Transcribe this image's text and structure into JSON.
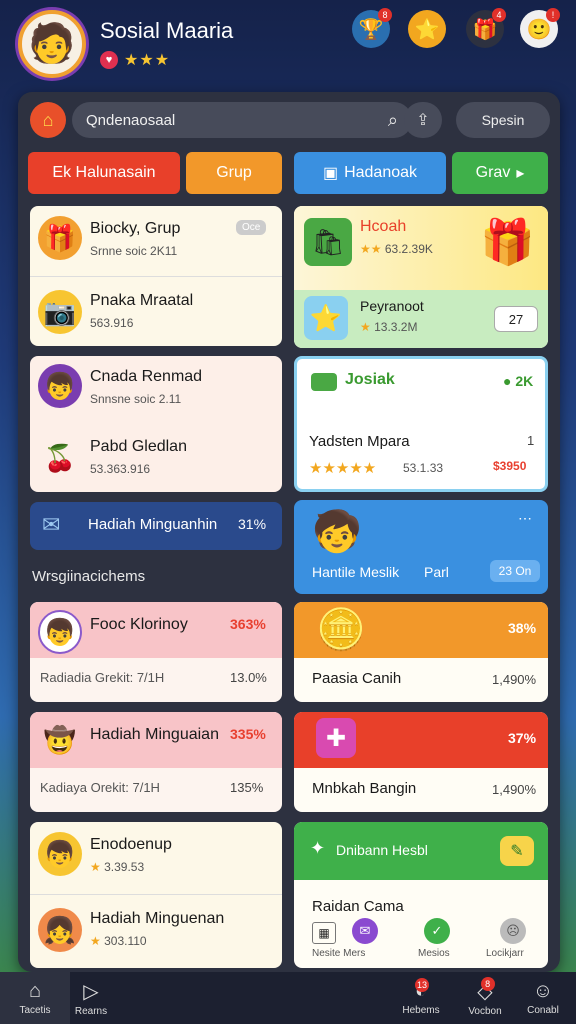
{
  "header": {
    "title": "Sosial Maaria",
    "stars": "★★★",
    "icons": [
      {
        "name": "trophy-icon",
        "badge": "8"
      },
      {
        "name": "star-icon",
        "badge": ""
      },
      {
        "name": "gift-icon",
        "badge": "4"
      },
      {
        "name": "profile-icon",
        "badge": "!"
      }
    ]
  },
  "search": {
    "placeholder": "Qndenaosaal",
    "button_label": "Spesin"
  },
  "tabs": [
    {
      "label": "Ek Halunasain"
    },
    {
      "label": "Grup"
    },
    {
      "label": "Hadanoak"
    },
    {
      "label": "Grav"
    }
  ],
  "left_cards": [
    {
      "title": "Biocky, Grup",
      "sub": "Srnne soic 2K11",
      "badge": "Oce"
    },
    {
      "title": "Pnaka Mraatal",
      "sub": "563.916"
    },
    {
      "title": "Cnada Renmad",
      "sub": "Snnsne soic 2.11"
    },
    {
      "title": "Pabd Gledlan",
      "sub": "53.363.916"
    },
    {
      "title": "Hadiah Minguanhin",
      "value": "31%"
    },
    {
      "section": "Wrsgiinacichems"
    },
    {
      "title": "Fooc Klorinoy",
      "pct": "363%",
      "sub": "Radiadia Grekit: 7/1H",
      "value": "13.0%"
    },
    {
      "title": "Hadiah Minguaian",
      "pct": "335%",
      "sub": "Kadiaya Orekit: 7/1H",
      "value": "135%"
    },
    {
      "title": "Enodoenup",
      "sub": "3.39.53"
    },
    {
      "title": "Hadiah Minguenan",
      "sub": "303.110"
    }
  ],
  "right_cards": [
    {
      "title": "Hcoah",
      "sub": "63.2.39K"
    },
    {
      "title": "Peyranoot",
      "sub": "13.3.2M",
      "value": "27"
    },
    {
      "title": "Josiak",
      "value": "2K"
    },
    {
      "title": "Yadsten Mpara",
      "sub": "53.1.33",
      "value": "1",
      "badge": "$3950"
    },
    {
      "title": "Hantile Meslik",
      "sub": "Parl",
      "value": "23 On"
    },
    {
      "pct": "38%",
      "title": "Paasia Canih",
      "value": "1,490%"
    },
    {
      "pct": "37%",
      "title": "Mnbkah Bangin",
      "value": "1,490%"
    },
    {
      "header": "Dnibann Hesbl",
      "title": "Raidan Cama"
    }
  ],
  "bottom_icons": [
    {
      "label": "Nesite Mers"
    },
    {
      "label": "Mesios"
    },
    {
      "label": "Locikjarr"
    }
  ],
  "nav": [
    {
      "label": "Tacetis"
    },
    {
      "label": "Rearns"
    },
    {
      "label": "Hebems",
      "badge": "13"
    },
    {
      "label": "Vocbon",
      "badge": "8"
    },
    {
      "label": "Conabl"
    }
  ]
}
